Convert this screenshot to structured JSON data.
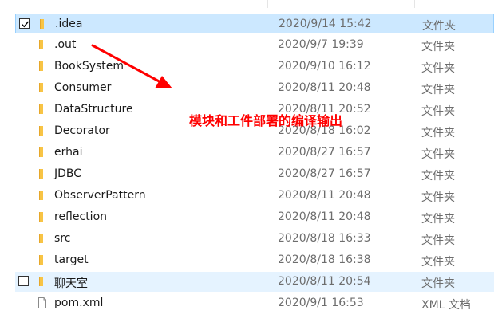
{
  "colors": {
    "selected_bg": "#cce8ff",
    "selected_border": "#99d1ff",
    "hover_bg": "#e5f3ff",
    "folder_yellow": "#f8c445",
    "annotation_red": "#ff0000"
  },
  "files": [
    {
      "name": ".idea",
      "date": "2020/9/14 15:42",
      "type": "文件夹",
      "icon": "folder-icon",
      "state": "selected",
      "checked": true
    },
    {
      "name": ".out",
      "date": "2020/9/7 19:39",
      "type": "文件夹",
      "icon": "folder-icon",
      "state": "normal",
      "checked": false
    },
    {
      "name": "BookSystem",
      "date": "2020/9/10 16:12",
      "type": "文件夹",
      "icon": "folder-icon",
      "state": "normal",
      "checked": false
    },
    {
      "name": "Consumer",
      "date": "2020/8/11 20:48",
      "type": "文件夹",
      "icon": "folder-icon",
      "state": "normal",
      "checked": false
    },
    {
      "name": "DataStructure",
      "date": "2020/8/11 20:52",
      "type": "文件夹",
      "icon": "folder-icon",
      "state": "normal",
      "checked": false
    },
    {
      "name": "Decorator",
      "date": "2020/8/18 16:02",
      "type": "文件夹",
      "icon": "folder-icon",
      "state": "normal",
      "checked": false
    },
    {
      "name": "erhai",
      "date": "2020/8/27 16:57",
      "type": "文件夹",
      "icon": "folder-icon",
      "state": "normal",
      "checked": false
    },
    {
      "name": "JDBC",
      "date": "2020/8/27 16:57",
      "type": "文件夹",
      "icon": "folder-icon",
      "state": "normal",
      "checked": false
    },
    {
      "name": "ObserverPattern",
      "date": "2020/8/11 20:48",
      "type": "文件夹",
      "icon": "folder-icon",
      "state": "normal",
      "checked": false
    },
    {
      "name": "reflection",
      "date": "2020/8/11 20:48",
      "type": "文件夹",
      "icon": "folder-icon",
      "state": "normal",
      "checked": false
    },
    {
      "name": "src",
      "date": "2020/8/18 16:33",
      "type": "文件夹",
      "icon": "folder-icon",
      "state": "normal",
      "checked": false
    },
    {
      "name": "target",
      "date": "2020/8/18 16:38",
      "type": "文件夹",
      "icon": "folder-icon",
      "state": "normal",
      "checked": false
    },
    {
      "name": "聊天室",
      "date": "2020/8/11 20:54",
      "type": "文件夹",
      "icon": "folder-icon",
      "state": "hover",
      "checked": false
    },
    {
      "name": "pom.xml",
      "date": "2020/9/1 16:53",
      "type": "XML 文档",
      "icon": "document-icon",
      "state": "normal",
      "checked": false
    }
  ],
  "annotation": {
    "text": "模块和工件部署的编译输出"
  }
}
